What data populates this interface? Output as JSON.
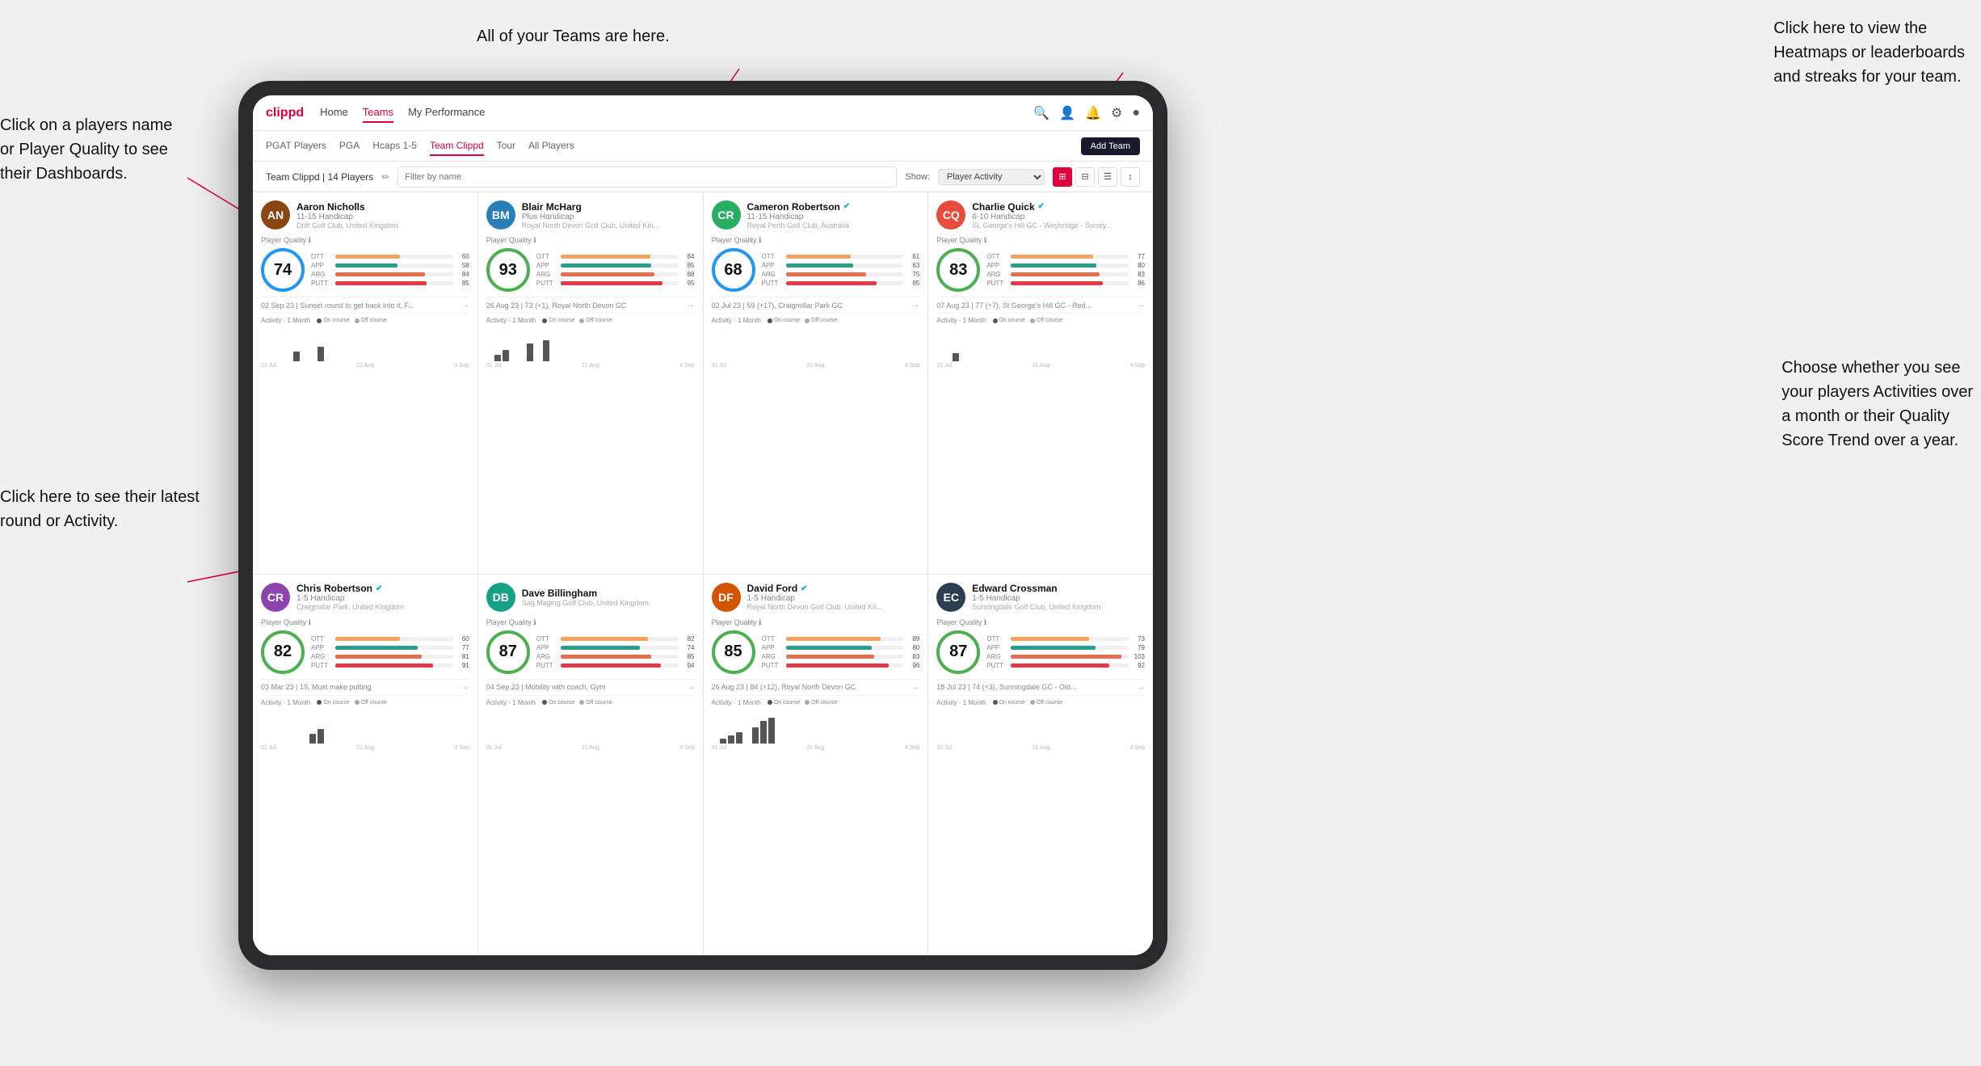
{
  "annotations": {
    "top_center": "All of your Teams are here.",
    "top_right": "Click here to view the\nHeatmaps or leaderboards\nand streaks for your team.",
    "left_top": "Click on a players name\nor Player Quality to see\ntheir Dashboards.",
    "left_bottom": "Click here to see their latest\nround or Activity.",
    "right_bottom": "Choose whether you see\nyour players Activities over\na month or their Quality\nScore Trend over a year."
  },
  "nav": {
    "logo": "clippd",
    "links": [
      "Home",
      "Teams",
      "My Performance"
    ],
    "active_link": "Teams"
  },
  "subnav": {
    "tabs": [
      "PGAT Players",
      "PGA",
      "Hcaps 1-5",
      "Team Clippd",
      "Tour",
      "All Players"
    ],
    "active_tab": "Team Clippd",
    "add_btn": "Add Team"
  },
  "teambar": {
    "title": "Team Clippd | 14 Players",
    "search_placeholder": "Filter by name",
    "show_label": "Show:",
    "show_option": "Player Activity",
    "view_icons": [
      "⊞",
      "⊟",
      "≡",
      "↕"
    ]
  },
  "players": [
    {
      "name": "Aaron Nicholls",
      "handicap": "11-15 Handicap",
      "club": "Drift Golf Club, United Kingdom",
      "quality": 74,
      "quality_color": "blue",
      "stats": [
        {
          "label": "OTT",
          "value": 60,
          "color": "#f4a261"
        },
        {
          "label": "APP",
          "value": 58,
          "color": "#2a9d8f"
        },
        {
          "label": "ARG",
          "value": 84,
          "color": "#e76f51"
        },
        {
          "label": "PUTT",
          "value": 85,
          "color": "#e63946"
        }
      ],
      "latest": "02 Sep 23 | Sunset round to get back into it, F...",
      "activity_label": "Activity · 1 Month",
      "bars": [
        0,
        0,
        0,
        0,
        12,
        0,
        0,
        18,
        0
      ],
      "dates": [
        "31 Jul",
        "21 Aug",
        "4 Sep"
      ]
    },
    {
      "name": "Blair McHarg",
      "handicap": "Plus Handicap",
      "club": "Royal North Devon Golf Club, United Kin...",
      "quality": 93,
      "quality_color": "green",
      "stats": [
        {
          "label": "OTT",
          "value": 84,
          "color": "#f4a261"
        },
        {
          "label": "APP",
          "value": 85,
          "color": "#2a9d8f"
        },
        {
          "label": "ARG",
          "value": 88,
          "color": "#e76f51"
        },
        {
          "label": "PUTT",
          "value": 95,
          "color": "#e63946"
        }
      ],
      "latest": "26 Aug 23 | 73 (+1), Royal North Devon GC",
      "activity_label": "Activity · 1 Month",
      "bars": [
        0,
        8,
        14,
        0,
        0,
        22,
        0,
        26,
        0
      ],
      "dates": [
        "31 Jul",
        "21 Aug",
        "4 Sep"
      ]
    },
    {
      "name": "Cameron Robertson",
      "verified": true,
      "handicap": "11-15 Handicap",
      "club": "Royal Perth Golf Club, Australia",
      "quality": 68,
      "quality_color": "blue",
      "stats": [
        {
          "label": "OTT",
          "value": 61,
          "color": "#f4a261"
        },
        {
          "label": "APP",
          "value": 63,
          "color": "#2a9d8f"
        },
        {
          "label": "ARG",
          "value": 75,
          "color": "#e76f51"
        },
        {
          "label": "PUTT",
          "value": 85,
          "color": "#e63946"
        }
      ],
      "latest": "02 Jul 23 | 59 (+17), Craigmillar Park GC",
      "activity_label": "Activity · 1 Month",
      "bars": [
        0,
        0,
        0,
        0,
        0,
        0,
        0,
        0,
        0
      ],
      "dates": [
        "31 Jul",
        "21 Aug",
        "4 Sep"
      ]
    },
    {
      "name": "Charlie Quick",
      "verified": true,
      "handicap": "6-10 Handicap",
      "club": "St. George's Hill GC - Weybridge - Surrey...",
      "quality": 83,
      "quality_color": "green",
      "stats": [
        {
          "label": "OTT",
          "value": 77,
          "color": "#f4a261"
        },
        {
          "label": "APP",
          "value": 80,
          "color": "#2a9d8f"
        },
        {
          "label": "ARG",
          "value": 83,
          "color": "#e76f51"
        },
        {
          "label": "PUTT",
          "value": 86,
          "color": "#e63946"
        }
      ],
      "latest": "07 Aug 23 | 77 (+7), St George's Hill GC - Red...",
      "activity_label": "Activity · 1 Month",
      "bars": [
        0,
        0,
        10,
        0,
        0,
        0,
        0,
        0,
        0
      ],
      "dates": [
        "31 Jul",
        "21 Aug",
        "4 Sep"
      ]
    },
    {
      "name": "Chris Robertson",
      "verified": true,
      "handicap": "1-5 Handicap",
      "club": "Craigmillar Park, United Kingdom",
      "quality": 82,
      "quality_color": "green",
      "stats": [
        {
          "label": "OTT",
          "value": 60,
          "color": "#f4a261"
        },
        {
          "label": "APP",
          "value": 77,
          "color": "#2a9d8f"
        },
        {
          "label": "ARG",
          "value": 81,
          "color": "#e76f51"
        },
        {
          "label": "PUTT",
          "value": 91,
          "color": "#e63946"
        }
      ],
      "latest": "03 Mar 23 | 19, Must make putting",
      "activity_label": "Activity · 1 Month",
      "bars": [
        0,
        0,
        0,
        0,
        0,
        0,
        12,
        18,
        0
      ],
      "dates": [
        "31 Jul",
        "21 Aug",
        "4 Sep"
      ]
    },
    {
      "name": "Dave Billingham",
      "handicap": "",
      "club": "Sag Maging Golf Club, United Kingdom",
      "quality": 87,
      "quality_color": "green",
      "stats": [
        {
          "label": "OTT",
          "value": 82,
          "color": "#f4a261"
        },
        {
          "label": "APP",
          "value": 74,
          "color": "#2a9d8f"
        },
        {
          "label": "ARG",
          "value": 85,
          "color": "#e76f51"
        },
        {
          "label": "PUTT",
          "value": 94,
          "color": "#e63946"
        }
      ],
      "latest": "04 Sep 23 | Mobility with coach, Gym",
      "activity_label": "Activity · 1 Month",
      "bars": [
        0,
        0,
        0,
        0,
        0,
        0,
        0,
        0,
        0
      ],
      "dates": [
        "31 Jul",
        "21 Aug",
        "4 Sep"
      ]
    },
    {
      "name": "David Ford",
      "verified": true,
      "handicap": "1-5 Handicap",
      "club": "Royal North Devon Golf Club, United Kil...",
      "quality": 85,
      "quality_color": "green",
      "stats": [
        {
          "label": "OTT",
          "value": 89,
          "color": "#f4a261"
        },
        {
          "label": "APP",
          "value": 80,
          "color": "#2a9d8f"
        },
        {
          "label": "ARG",
          "value": 83,
          "color": "#e76f51"
        },
        {
          "label": "PUTT",
          "value": 96,
          "color": "#e63946"
        }
      ],
      "latest": "26 Aug 23 | 84 (+12), Royal North Devon GC",
      "activity_label": "Activity · 1 Month",
      "bars": [
        0,
        6,
        10,
        14,
        0,
        20,
        28,
        32,
        0
      ],
      "dates": [
        "31 Jul",
        "21 Aug",
        "4 Sep"
      ]
    },
    {
      "name": "Edward Crossman",
      "handicap": "1-5 Handicap",
      "club": "Sunningdale Golf Club, United Kingdom",
      "quality": 87,
      "quality_color": "green",
      "stats": [
        {
          "label": "OTT",
          "value": 73,
          "color": "#f4a261"
        },
        {
          "label": "APP",
          "value": 79,
          "color": "#2a9d8f"
        },
        {
          "label": "ARG",
          "value": 103,
          "color": "#e76f51"
        },
        {
          "label": "PUTT",
          "value": 92,
          "color": "#e63946"
        }
      ],
      "latest": "18 Jul 23 | 74 (+3), Sunningdale GC - Old...",
      "activity_label": "Activity · 1 Month",
      "bars": [
        0,
        0,
        0,
        0,
        0,
        0,
        0,
        0,
        0
      ],
      "dates": [
        "31 Jul",
        "21 Aug",
        "4 Sep"
      ]
    }
  ],
  "avatar_colors": [
    "#8B4513",
    "#2980b9",
    "#27ae60",
    "#e74c3c",
    "#8e44ad",
    "#16a085",
    "#d35400",
    "#2c3e50"
  ],
  "avatar_initials": [
    "AN",
    "BM",
    "CR",
    "CQ",
    "CR",
    "DB",
    "DF",
    "EC"
  ]
}
